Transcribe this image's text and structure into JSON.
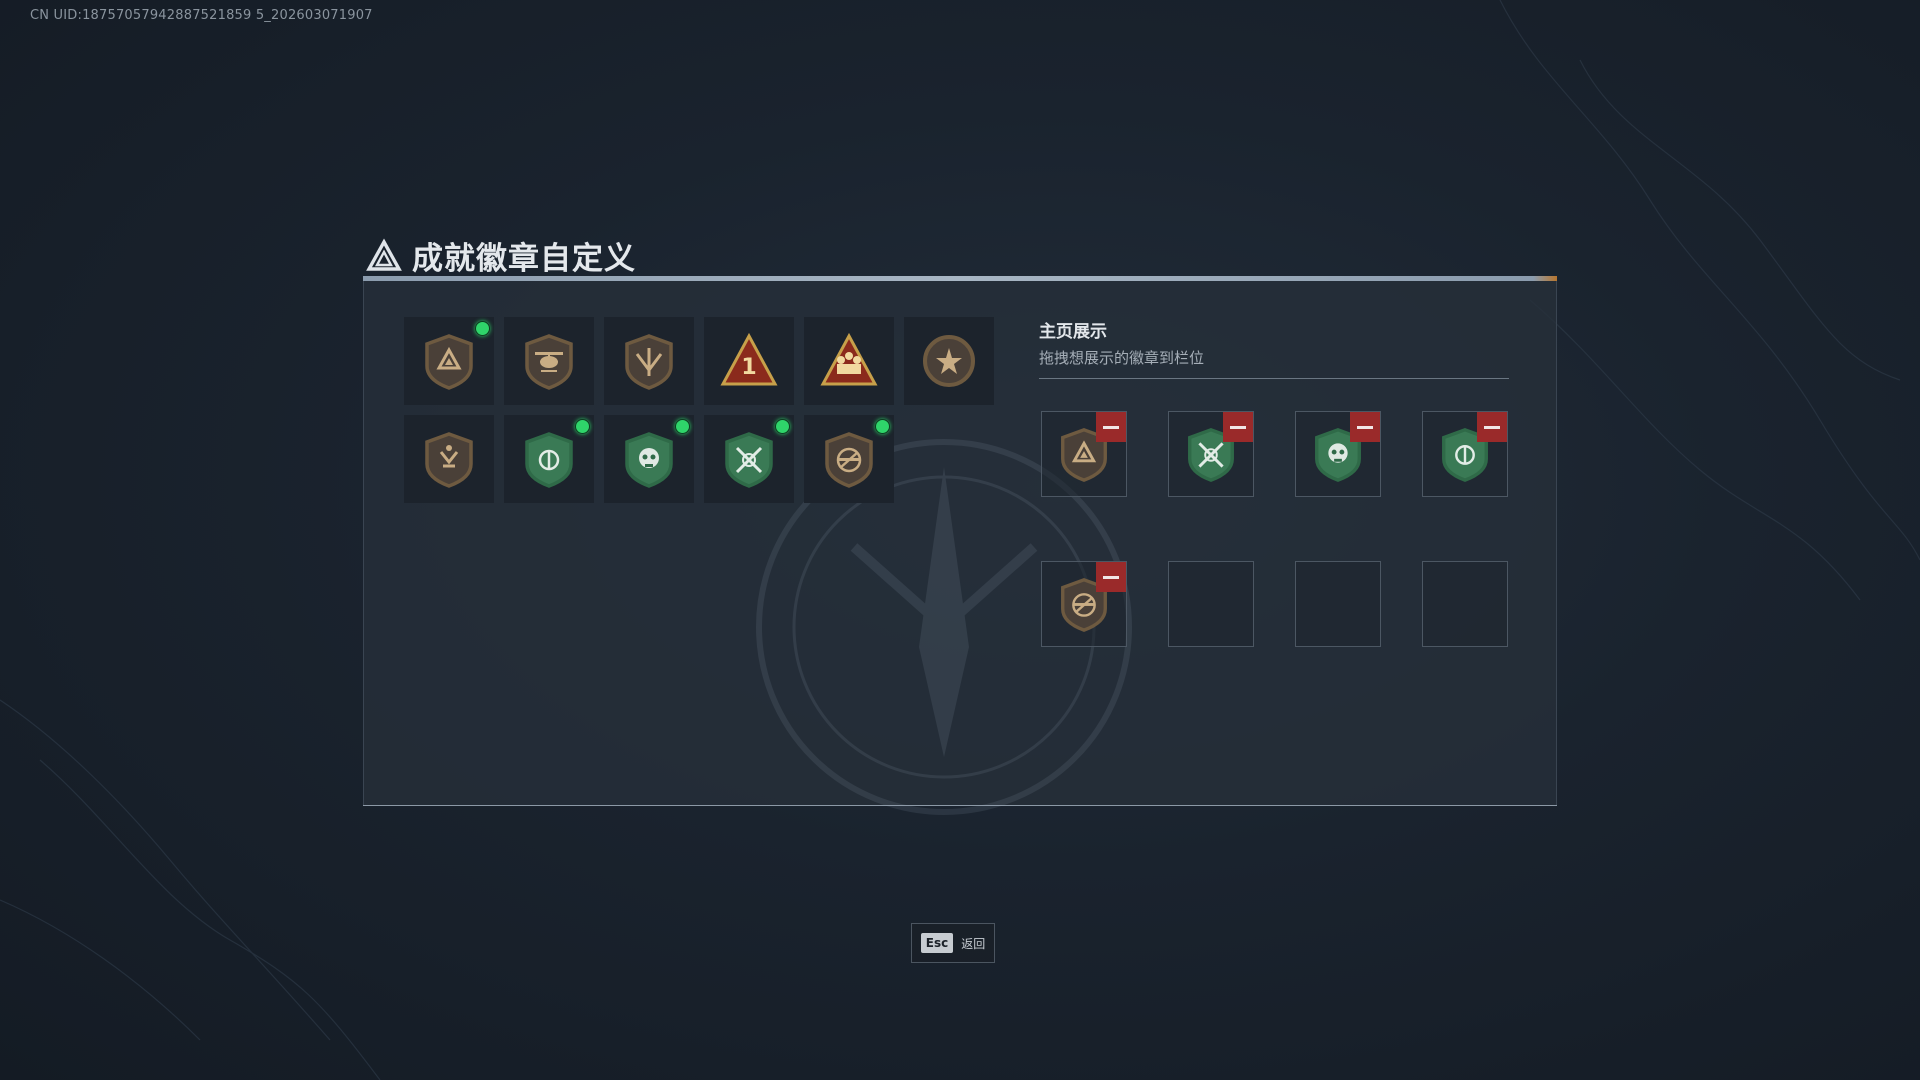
{
  "uid_text": "CN UID:18757057942887521859 5_202603071907",
  "title": "成就徽章自定义",
  "badges": [
    {
      "icon": "shield-triangle-badge-icon",
      "theme": "bronze",
      "equipped": true
    },
    {
      "icon": "helicopter-badge-icon",
      "theme": "bronze",
      "equipped": false
    },
    {
      "icon": "wings-shield-badge-icon",
      "theme": "bronze",
      "equipped": false
    },
    {
      "icon": "number-one-triangle-badge-icon",
      "theme": "gold",
      "equipped": false
    },
    {
      "icon": "squad-triangle-badge-icon",
      "theme": "gold",
      "equipped": false
    },
    {
      "icon": "star-medal-badge-icon",
      "theme": "bronze",
      "equipped": false
    },
    {
      "icon": "eagle-shield-badge-icon",
      "theme": "bronze",
      "equipped": false
    },
    {
      "icon": "green-crest-badge-icon",
      "theme": "green",
      "equipped": true
    },
    {
      "icon": "green-skull-badge-icon",
      "theme": "green",
      "equipped": true
    },
    {
      "icon": "green-crossed-rifles-badge-icon",
      "theme": "green",
      "equipped": true
    },
    {
      "icon": "no-rifle-badge-icon",
      "theme": "bronze",
      "equipped": true
    }
  ],
  "showcase": {
    "title": "主页展示",
    "subtitle": "拖拽想展示的徽章到栏位",
    "slots": [
      {
        "icon": "shield-triangle-badge-icon",
        "theme": "bronze",
        "filled": true
      },
      {
        "icon": "green-crossed-rifles-badge-icon",
        "theme": "green",
        "filled": true
      },
      {
        "icon": "green-skull-badge-icon",
        "theme": "green",
        "filled": true
      },
      {
        "icon": "green-crest-badge-icon",
        "theme": "green",
        "filled": true
      },
      {
        "icon": "no-rifle-badge-icon",
        "theme": "bronze",
        "filled": true
      },
      {
        "icon": "",
        "theme": "",
        "filled": false
      },
      {
        "icon": "",
        "theme": "",
        "filled": false
      },
      {
        "icon": "",
        "theme": "",
        "filled": false
      }
    ]
  },
  "footer": {
    "esc_key": "Esc",
    "esc_label": "返回"
  },
  "colors": {
    "equipped_dot": "#2fd46a",
    "remove_button": "#9a2a2a",
    "bronze": "#b89a72",
    "gold": "#c7a04a",
    "green": "#3a7a55"
  }
}
